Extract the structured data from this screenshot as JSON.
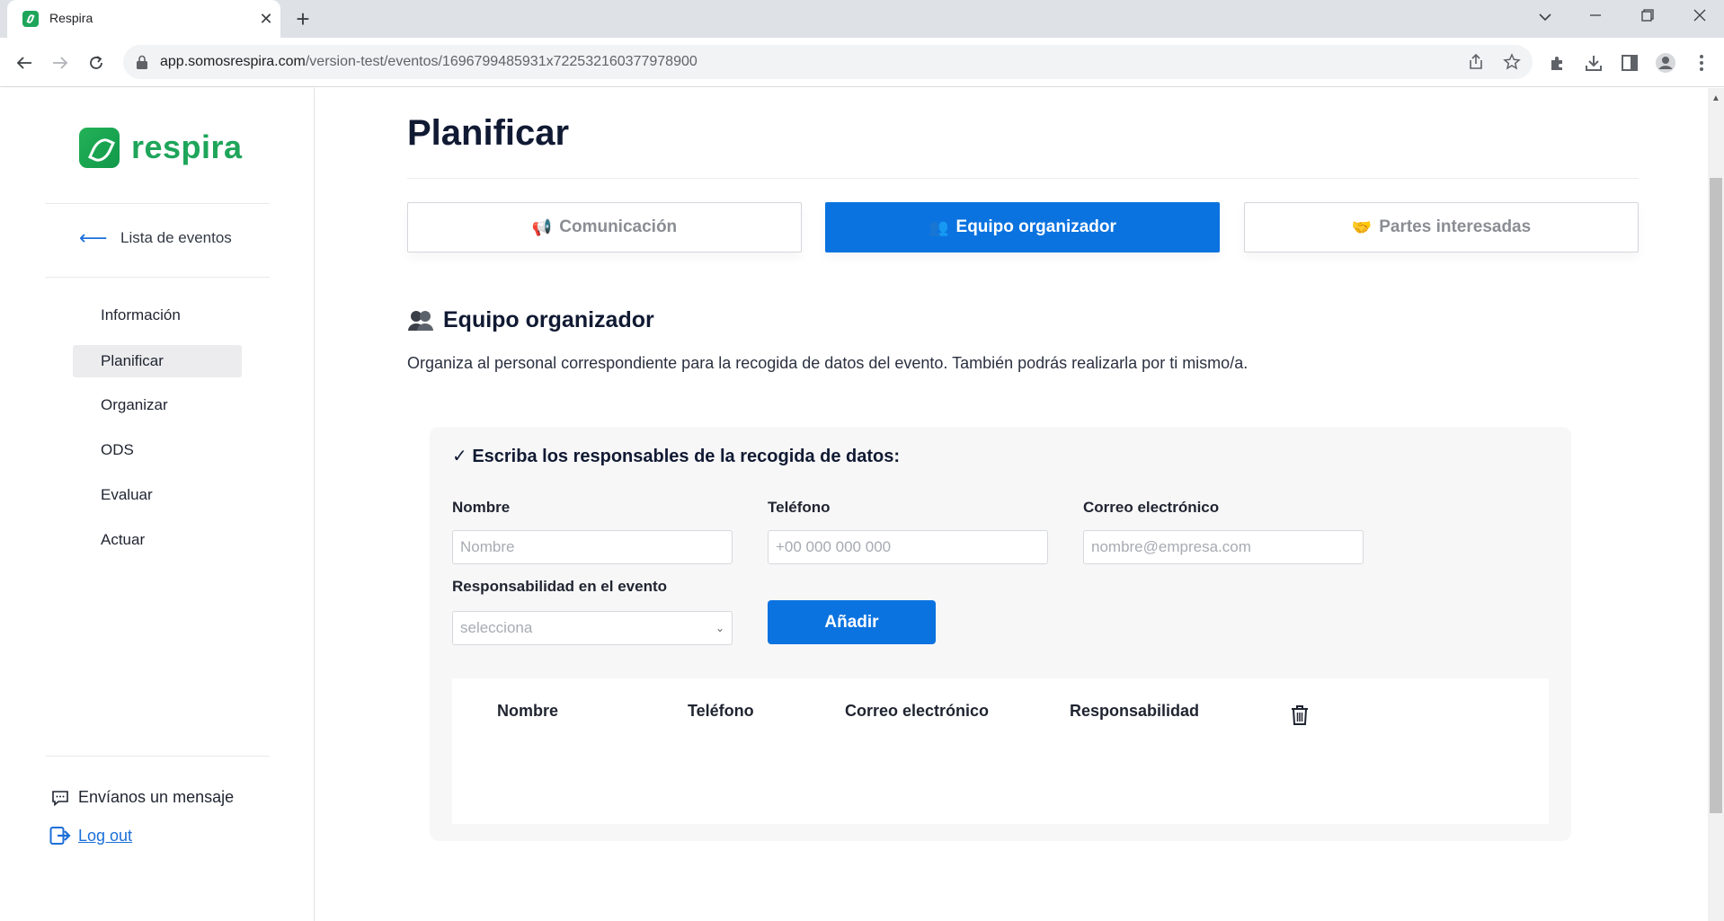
{
  "browser": {
    "tab_title": "Respira",
    "url_host": "app.somosrespira.com",
    "url_path": "/version-test/eventos/1696799485931x722532160377978900"
  },
  "sidebar": {
    "brand": "respira",
    "back_label": "Lista de eventos",
    "items": [
      {
        "label": "Información",
        "active": false
      },
      {
        "label": "Planificar",
        "active": true
      },
      {
        "label": "Organizar",
        "active": false
      },
      {
        "label": "ODS",
        "active": false
      },
      {
        "label": "Evaluar",
        "active": false
      },
      {
        "label": "Actuar",
        "active": false
      }
    ],
    "message_label": "Envíanos un mensaje",
    "logout_label": "Log out"
  },
  "main": {
    "title": "Planificar",
    "tabs": [
      {
        "label": "Comunicación",
        "icon": "megaphone-icon",
        "emoji": "📢",
        "active": false
      },
      {
        "label": "Equipo organizador",
        "icon": "people-icon",
        "emoji": "👥",
        "active": true
      },
      {
        "label": "Partes interesadas",
        "icon": "handshake-icon",
        "emoji": "🤝",
        "active": false
      }
    ],
    "section_title": "Equipo organizador",
    "section_description": "Organiza al personal correspondiente para la recogida de datos del evento. También podrás realizarla por ti mismo/a.",
    "form": {
      "heading": "✓ Escriba los responsables de la recogida de datos:",
      "name_label": "Nombre",
      "name_placeholder": "Nombre",
      "phone_label": "Teléfono",
      "phone_placeholder": "+00 000 000 000",
      "email_label": "Correo electrónico",
      "email_placeholder": "nombre@empresa.com",
      "role_label": "Responsabilidad en el evento",
      "role_value": "selecciona",
      "add_label": "Añadir"
    },
    "table": {
      "headers": [
        "Nombre",
        "Teléfono",
        "Correo electrónico",
        "Responsabilidad"
      ],
      "rows": []
    }
  },
  "colors": {
    "brand_green": "#1ea55a",
    "accent_blue": "#0b73e0"
  }
}
